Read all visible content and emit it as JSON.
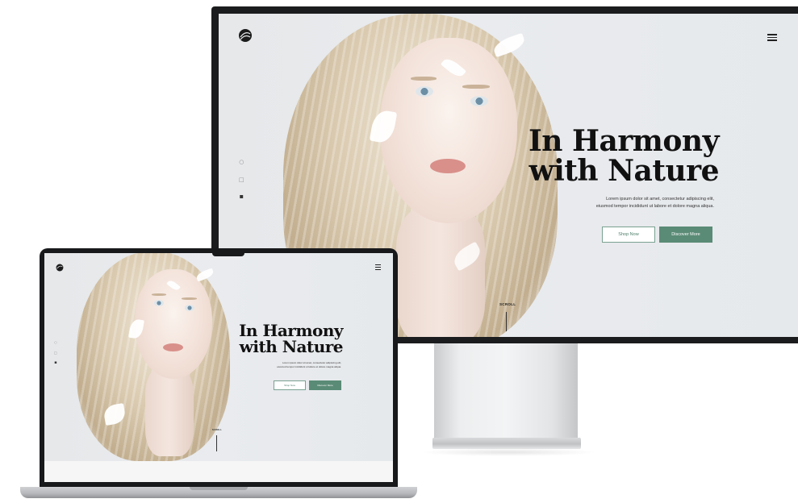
{
  "hero": {
    "title_line1": "In Harmony",
    "title_line2": "with Nature",
    "description_line1": "Lorem ipsum dolor sit amet, consectetur adipiscing elit,",
    "description_line2": "eiusmod tempor incididunt ut labore et dolore magna aliqua.",
    "buttons": {
      "shop_now": "Shop Now",
      "discover_more": "Discover More"
    },
    "scroll_label": "SCROLL"
  },
  "nav": {
    "logo_icon": "leaf-logo-icon",
    "menu_icon": "hamburger-menu-icon"
  },
  "social_icons": [
    "facebook-icon",
    "instagram-icon",
    "twitter-icon"
  ],
  "colors": {
    "accent": "#5a8b76",
    "accent_outline": "#7aa191",
    "text": "#111111",
    "background": "#e8eaec"
  }
}
